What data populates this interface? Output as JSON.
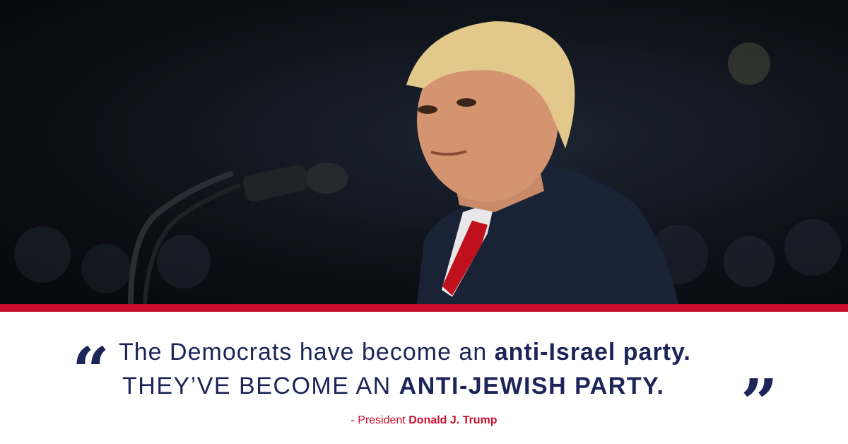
{
  "quote": {
    "open_mark": "“",
    "close_mark": "”",
    "line1_regular": "The Democrats have become an ",
    "line1_bold": "anti-Israel party.",
    "line2_regular": "THEY’VE BECOME AN ",
    "line2_bold": "ANTI-JEWISH PARTY."
  },
  "attribution": {
    "prefix": "- President ",
    "name": "Donald J. Trump"
  },
  "colors": {
    "navy": "#1c2458",
    "red": "#c8102e",
    "white": "#ffffff"
  }
}
